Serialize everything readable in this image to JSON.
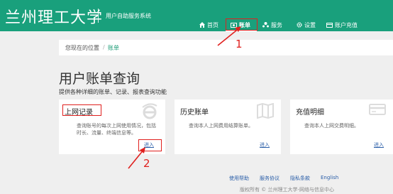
{
  "header": {
    "logo": "兰州理工大学",
    "subsystem": "用户自助服务系统",
    "nav": [
      {
        "label": "首页",
        "icon": "home-icon"
      },
      {
        "label": "账单",
        "icon": "bill-icon"
      },
      {
        "label": "服务",
        "icon": "service-icon"
      },
      {
        "label": "设置",
        "icon": "gear-icon"
      },
      {
        "label": "账户充值",
        "icon": "recharge-icon"
      }
    ]
  },
  "breadcrumb": {
    "home": "您现在的位置",
    "sep": "/",
    "current": "账单"
  },
  "page": {
    "title": "用户账单查询",
    "subtitle": "提供各种详细的账单、记录、报表查询功能"
  },
  "cards": [
    {
      "title": "上网记录",
      "desc": "查询账号的每次上网使用情况，包括时长、流量、终端信息等。",
      "enter": "进入",
      "icon": "ie-icon"
    },
    {
      "title": "历史账单",
      "desc": "查询本人上网费用结算账单。",
      "enter": "进入",
      "icon": "map-icon"
    },
    {
      "title": "充值明细",
      "desc": "查询本人上网交费明细。",
      "enter": "进入",
      "icon": "card-icon"
    }
  ],
  "annotations": {
    "one": "1",
    "two": "2"
  },
  "footer": {
    "links": [
      "使用帮助",
      "服务协议",
      "隐私条款",
      "English"
    ],
    "copyright": "版权所有 © 兰州理工大学-网络与信息中心"
  },
  "colors": {
    "header": "#19a07c",
    "annotation": "#e0201e",
    "link": "#2a5ea8"
  }
}
